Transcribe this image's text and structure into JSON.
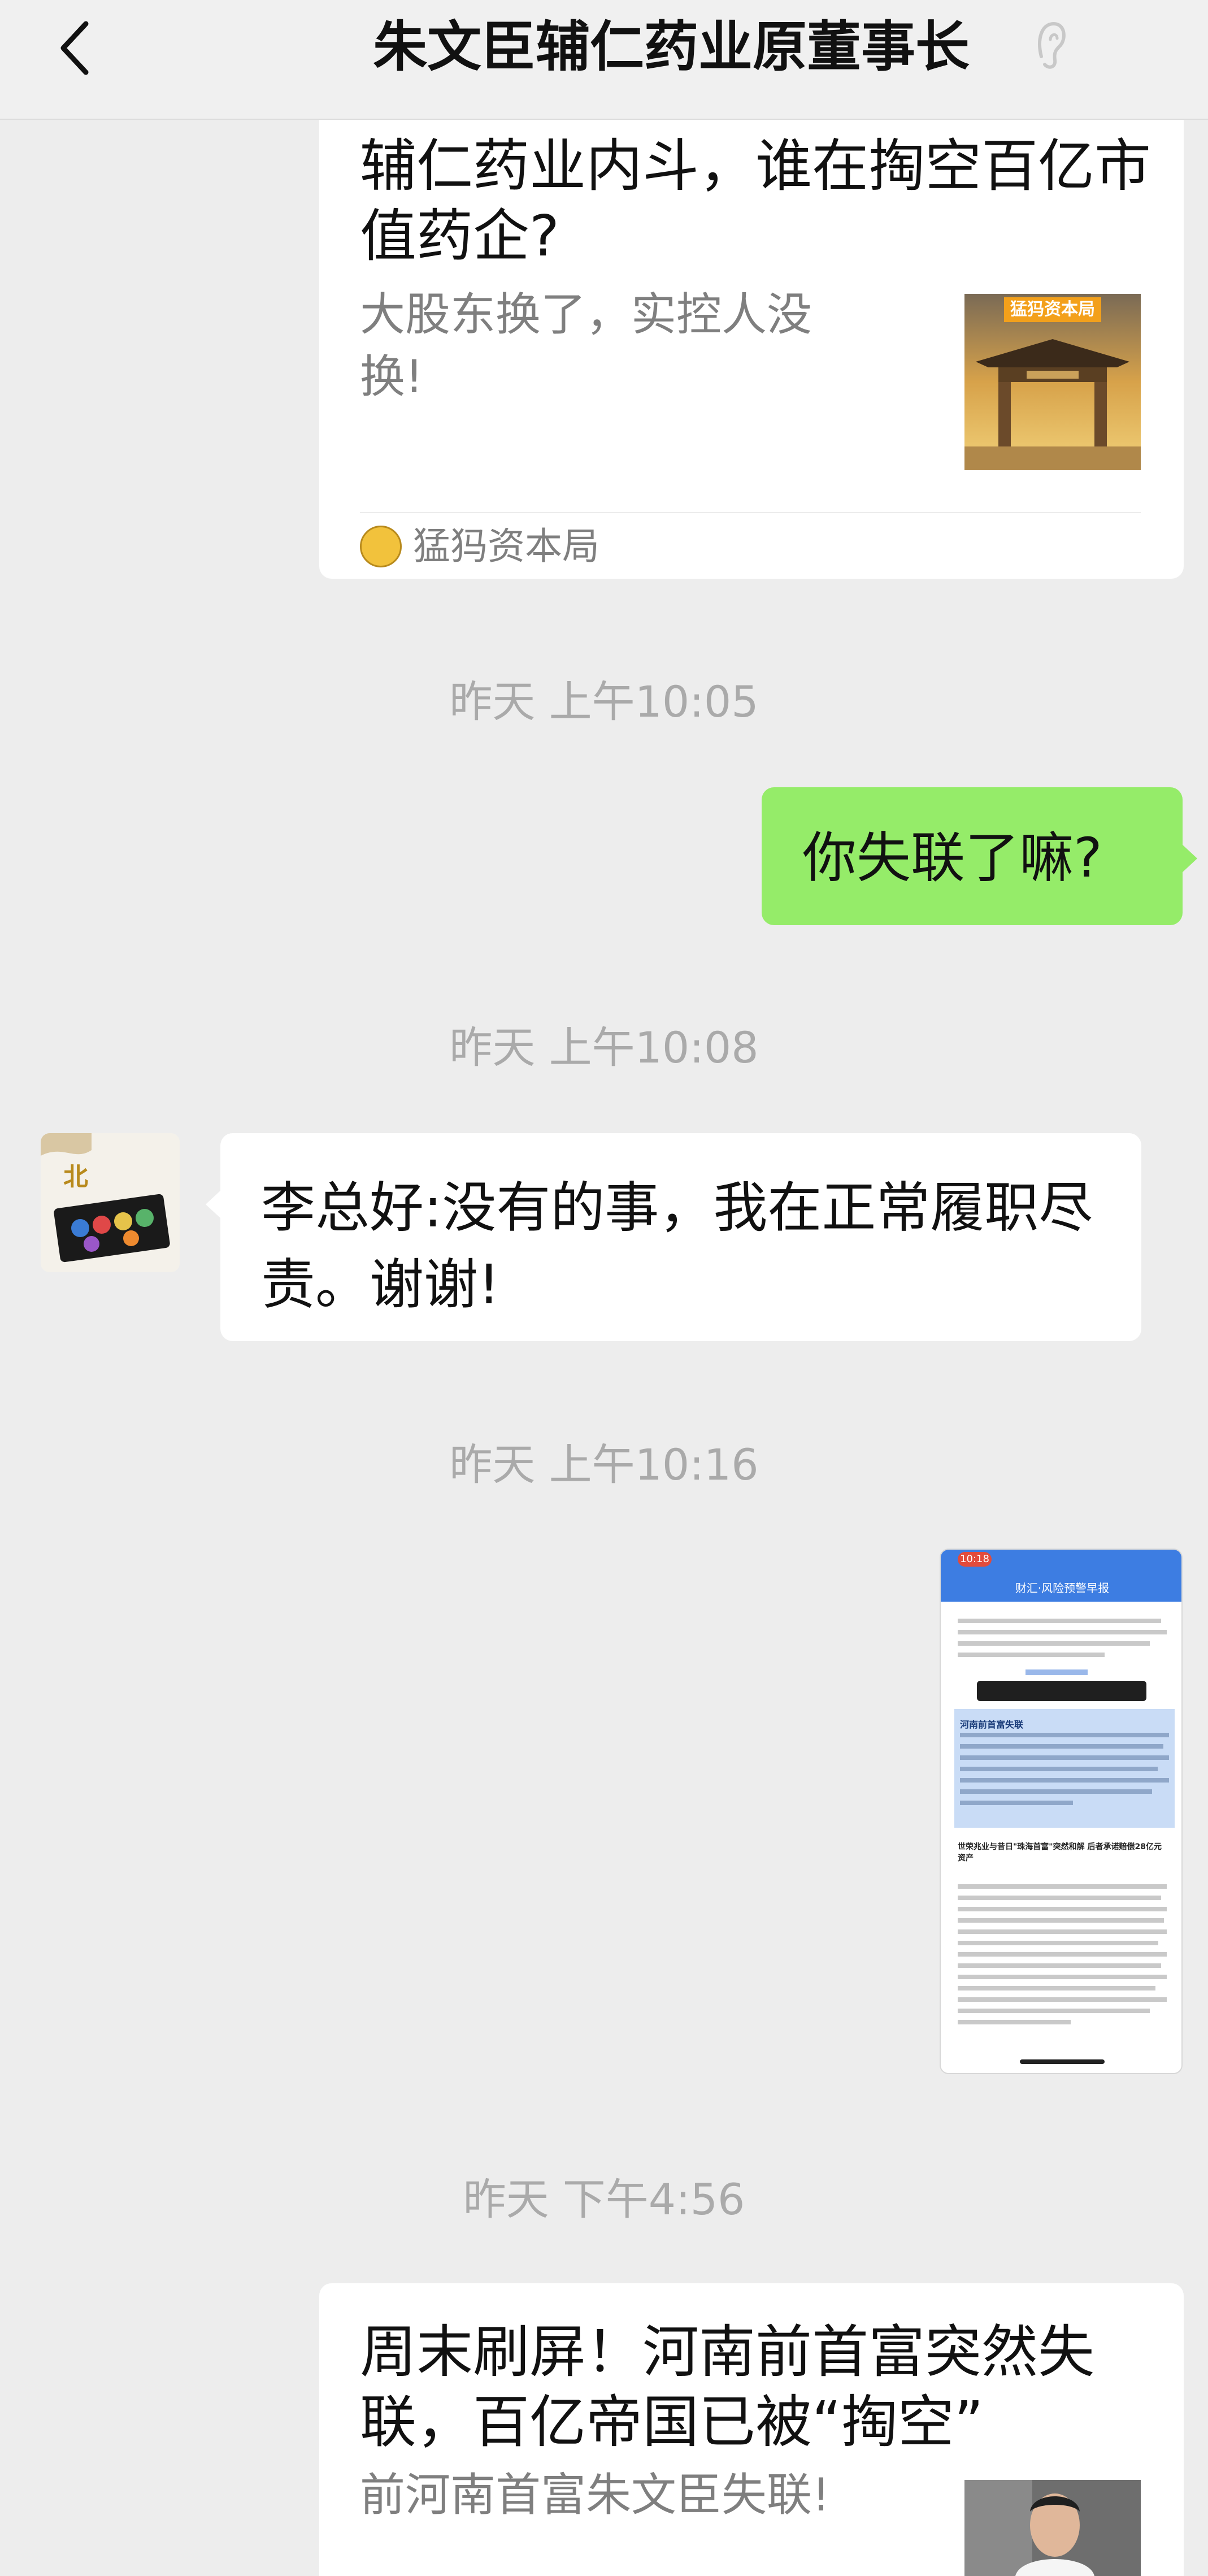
{
  "header": {
    "title": "朱文臣辅仁药业原董事长",
    "back_icon": "chevron-left-icon",
    "ear_icon": "ear-icon"
  },
  "colors": {
    "sent_bubble": "#95ec69",
    "recv_bubble": "#ffffff",
    "background": "#ededed"
  },
  "messages": {
    "card1": {
      "title": "辅仁药业内斗，谁在掏空百亿市值药企?",
      "desc": "大股东换了，实控人没换!",
      "thumb_badge": "猛犸资本局",
      "source": "猛犸资本局"
    },
    "time1": "昨天 上午10:05",
    "sent1": "你失联了嘛?",
    "time2": "昨天 上午10:08",
    "recv1": "李总好:没有的事，我在正常履职尽责。谢谢!",
    "time3": "昨天 上午10:16",
    "screenshot": {
      "status_time": "10:18",
      "nav_title": "财汇·风险预警早报",
      "heading": "河南前首富失联",
      "subheading": "世荣兆业与昔日\"珠海首富\"突然和解 后者承诺赔偿28亿元资产"
    },
    "time4": "昨天 下午4:56",
    "card2": {
      "title": "周末刷屏！河南前首富突然失联，百亿帝国已被“掏空”",
      "desc": "前河南首富朱文臣失联!"
    }
  }
}
